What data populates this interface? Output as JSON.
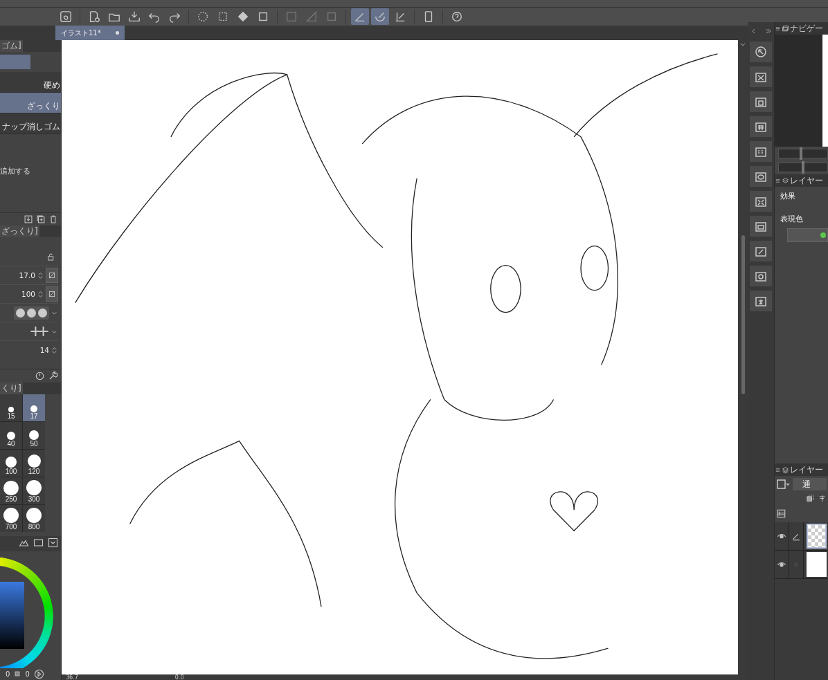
{
  "toolbar": {
    "snap_buttons": [
      {
        "selected": true
      },
      {
        "selected": true
      },
      {
        "selected": false
      }
    ]
  },
  "document_tab": {
    "title": "イラスト11*"
  },
  "subtool_panel": {
    "header": "ゴム]",
    "items": [
      {
        "label": "硬め",
        "selected": false
      },
      {
        "label": "ざっくり",
        "selected": true
      },
      {
        "label": "ナップ消しゴム",
        "selected": false
      }
    ],
    "add_text": "追加する"
  },
  "tool_property": {
    "tab": "ざっくり]",
    "rows": [
      {
        "kind": "number",
        "value": "17.0"
      },
      {
        "kind": "number",
        "value": "100"
      },
      {
        "kind": "tips"
      },
      {
        "kind": "strokes"
      },
      {
        "kind": "number",
        "value": "14"
      }
    ]
  },
  "brush_size": {
    "tab": "くり]",
    "sizes": [
      {
        "label": "15",
        "selected": false
      },
      {
        "label": "17",
        "selected": true
      },
      {
        "label": "40",
        "selected": false
      },
      {
        "label": "50",
        "selected": false
      },
      {
        "label": "100",
        "selected": false
      },
      {
        "label": "120",
        "selected": false
      },
      {
        "label": "250",
        "selected": false
      },
      {
        "label": "300",
        "selected": false
      },
      {
        "label": "700",
        "selected": false
      },
      {
        "label": "800",
        "selected": false
      }
    ]
  },
  "color_panel": {
    "readouts": [
      "0",
      "0"
    ]
  },
  "navigator": {
    "tab": "ナビゲー",
    "sliders": [
      {
        "level": 0.45
      },
      {
        "level": 0.5
      }
    ]
  },
  "layer_property": {
    "tab": "レイヤー",
    "effect_label": "効果",
    "expression_label": "表現色"
  },
  "layers_panel": {
    "tab": "レイヤー",
    "blend_mode": "通",
    "layers": [
      {
        "kind": "raster",
        "visible": true,
        "selected": true
      },
      {
        "kind": "paper",
        "visible": true,
        "selected": false
      }
    ]
  },
  "status_bar": {
    "zoom": "36.7",
    "angle": "0.0"
  }
}
